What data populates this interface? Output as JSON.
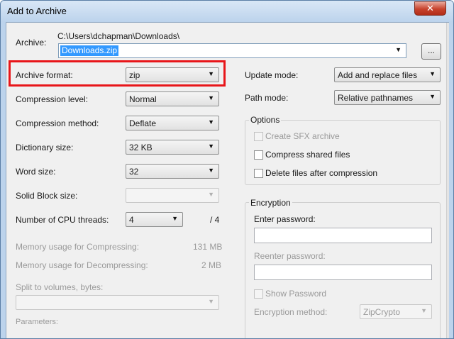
{
  "window": {
    "title": "Add to Archive",
    "close_glyph": "✕"
  },
  "archive": {
    "label": "Archive:",
    "path": "C:\\Users\\dchapman\\Downloads\\",
    "name_value": "Downloads.zip",
    "browse_label": "..."
  },
  "left": {
    "archive_format": {
      "label": "Archive format:",
      "value": "zip"
    },
    "compression_level": {
      "label": "Compression level:",
      "value": "Normal"
    },
    "compression_method": {
      "label": "Compression method:",
      "value": "Deflate"
    },
    "dictionary_size": {
      "label": "Dictionary size:",
      "value": "32 KB"
    },
    "word_size": {
      "label": "Word size:",
      "value": "32"
    },
    "solid_block_size": {
      "label": "Solid Block size:",
      "value": ""
    },
    "cpu_threads": {
      "label": "Number of CPU threads:",
      "value": "4",
      "max": "/ 4"
    },
    "memory_compressing": {
      "label": "Memory usage for Compressing:",
      "value": "131 MB"
    },
    "memory_decompressing": {
      "label": "Memory usage for Decompressing:",
      "value": "2 MB"
    },
    "split_volumes": {
      "label": "Split to volumes, bytes:",
      "value": ""
    },
    "parameters": {
      "label": "Parameters:"
    }
  },
  "right": {
    "update_mode": {
      "label": "Update mode:",
      "value": "Add and replace files"
    },
    "path_mode": {
      "label": "Path mode:",
      "value": "Relative pathnames"
    },
    "options": {
      "title": "Options",
      "create_sfx": "Create SFX archive",
      "compress_shared": "Compress shared files",
      "delete_after": "Delete files after compression"
    },
    "encryption": {
      "title": "Encryption",
      "enter_password": "Enter password:",
      "reenter_password": "Reenter password:",
      "show_password": "Show Password",
      "method_label": "Encryption method:",
      "method_value": "ZipCrypto"
    }
  },
  "icons": {
    "dropdown": "▼"
  },
  "colors": {
    "highlight": "#e8161a",
    "selection": "#3399ff",
    "close": "#c7422c"
  }
}
